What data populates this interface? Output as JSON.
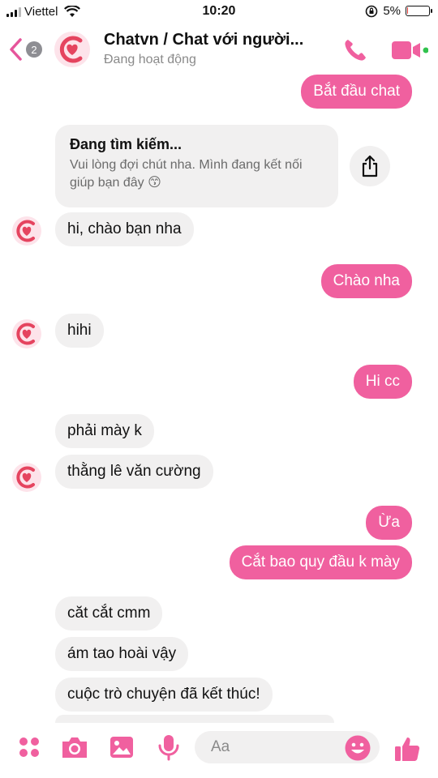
{
  "status_bar": {
    "carrier": "Viettel",
    "time": "10:20",
    "battery_percent": "5%",
    "battery_level": 0.05,
    "icons": [
      "signal-icon",
      "wifi-icon",
      "orientation-lock-icon",
      "battery-icon"
    ]
  },
  "header": {
    "back_count": "2",
    "title": "Chatvn / Chat với người...",
    "subtitle": "Đang hoạt động",
    "icons": [
      "back-chevron-icon",
      "phone-icon",
      "video-camera-icon"
    ]
  },
  "colors": {
    "accent": "#f0609f",
    "incoming_bubble": "#f1f0f0",
    "online_dot": "#31c24d"
  },
  "messages": [
    {
      "dir": "out",
      "text": "Bắt đầu chat"
    },
    {
      "dir": "card",
      "title": "Đang tìm kiếm...",
      "body": "Vui lòng đợi chút nha. Mình đang kết nối giúp bạn đây 😙"
    },
    {
      "dir": "in",
      "text": "hi, chào bạn nha"
    },
    {
      "dir": "out",
      "text": "Chào nha"
    },
    {
      "dir": "in",
      "text": "hihi"
    },
    {
      "dir": "out",
      "text": "Hi cc"
    },
    {
      "dir": "in",
      "text": "phải mày k"
    },
    {
      "dir": "in",
      "text": "thằng lê văn cường"
    },
    {
      "dir": "out",
      "text": "Ừa"
    },
    {
      "dir": "out",
      "text": "Cắt bao quy đầu k mày"
    },
    {
      "dir": "in",
      "text": "căt cắt cmm"
    },
    {
      "dir": "in",
      "text": "ám tao  hoài vậy"
    },
    {
      "dir": "in",
      "text": "cuộc trò chuyện đã kết thúc!"
    }
  ],
  "composer": {
    "placeholder": "Aa",
    "icons": [
      "apps-grid-icon",
      "camera-icon",
      "image-icon",
      "microphone-icon",
      "emoji-icon",
      "thumbs-up-icon"
    ]
  }
}
